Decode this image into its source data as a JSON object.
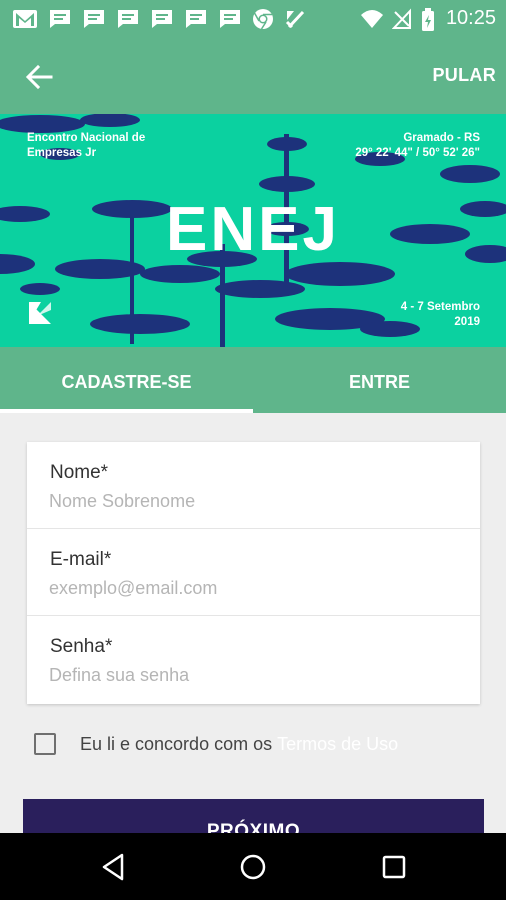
{
  "status_bar": {
    "time": "10:25",
    "notification_icons": [
      "gmail-icon",
      "message-icon",
      "message-icon",
      "message-icon",
      "message-icon",
      "message-icon",
      "message-icon",
      "chrome-icon",
      "task-icon"
    ],
    "system_icons": [
      "wifi-icon",
      "no-signal-icon",
      "battery-icon"
    ]
  },
  "app_bar": {
    "back_icon": "arrow-left-icon",
    "skip_label": "PULAR"
  },
  "banner": {
    "org_line1": "Encontro Nacional de",
    "org_line2": "Empresas Jr",
    "place": "Gramado - RS",
    "coords": "29° 22' 44\" / 50° 52' 26\"",
    "title": "ENEJ",
    "dates_line1": "4 - 7 Setembro",
    "dates_line2": "2019"
  },
  "tabs": [
    {
      "label": "CADASTRE-SE",
      "active": true
    },
    {
      "label": "ENTRE",
      "active": false
    }
  ],
  "form": {
    "name": {
      "label": "Nome*",
      "placeholder": "Nome Sobrenome",
      "value": ""
    },
    "email": {
      "label": "E-mail*",
      "placeholder": "exemplo@email.com",
      "value": ""
    },
    "password": {
      "label": "Senha*",
      "placeholder": "Defina sua senha",
      "value": ""
    }
  },
  "terms": {
    "text": "Eu li e concordo com os",
    "link": "Termos de Uso",
    "checked": false
  },
  "next_button": {
    "label": "PRÓXIMO"
  },
  "nav_bar": [
    "back-triangle-icon",
    "home-circle-icon",
    "recents-square-icon"
  ],
  "colors": {
    "primary": "#5fb58b",
    "banner": "#0bd1a0",
    "accent_dark": "#2a1f5c",
    "background": "#eeeeee"
  }
}
